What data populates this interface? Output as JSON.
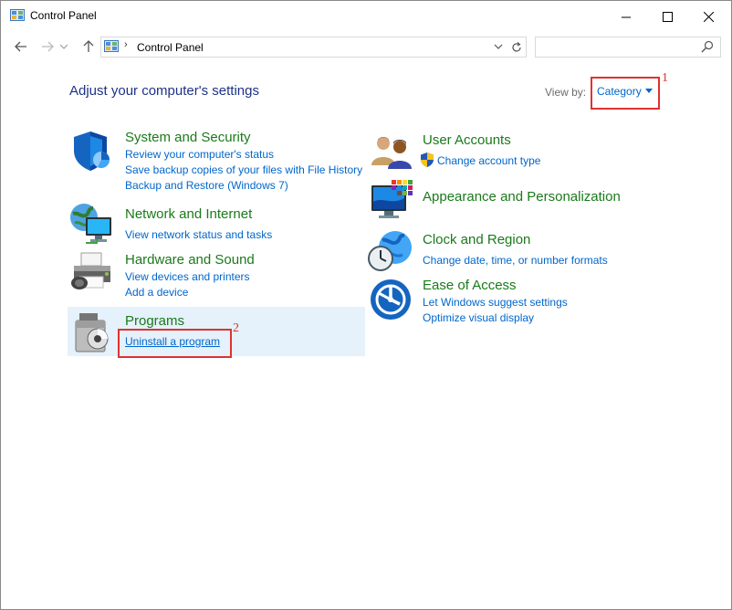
{
  "window": {
    "title": "Control Panel",
    "buttons": {
      "minimize": "—",
      "maximize": "☐",
      "close": "✕"
    }
  },
  "navigation": {
    "breadcrumb_separator": "›",
    "breadcrumb": "Control Panel",
    "search_placeholder": ""
  },
  "content": {
    "heading": "Adjust your computer's settings",
    "view_by_label": "View by:",
    "view_by_value": "Category"
  },
  "annotations": {
    "one": "1",
    "two": "2",
    "color": "#e0322f"
  },
  "left_categories": [
    {
      "title": "System and Security",
      "icon": "shield-icon",
      "links": [
        "Review your computer's status",
        "Save backup copies of your files with File History",
        "Backup and Restore (Windows 7)"
      ]
    },
    {
      "title": "Network and Internet",
      "icon": "network-icon",
      "links": [
        "View network status and tasks"
      ]
    },
    {
      "title": "Hardware and Sound",
      "icon": "printer-icon",
      "links": [
        "View devices and printers",
        "Add a device"
      ]
    },
    {
      "title": "Programs",
      "icon": "programs-icon",
      "links": [
        "Uninstall a program"
      ]
    }
  ],
  "right_categories": [
    {
      "title": "User Accounts",
      "icon": "users-icon",
      "links": [
        "Change account type"
      ]
    },
    {
      "title": "Appearance and Personalization",
      "icon": "monitor-palette-icon",
      "links": []
    },
    {
      "title": "Clock and Region",
      "icon": "clock-globe-icon",
      "links": [
        "Change date, time, or number formats"
      ]
    },
    {
      "title": "Ease of Access",
      "icon": "ease-of-access-icon",
      "links": [
        "Let Windows suggest settings",
        "Optimize visual display"
      ]
    }
  ],
  "colors": {
    "category_title": "#1a7a1a",
    "link": "#0066cc",
    "heading": "#1e3287",
    "hover_background": "#e5f1fb"
  }
}
